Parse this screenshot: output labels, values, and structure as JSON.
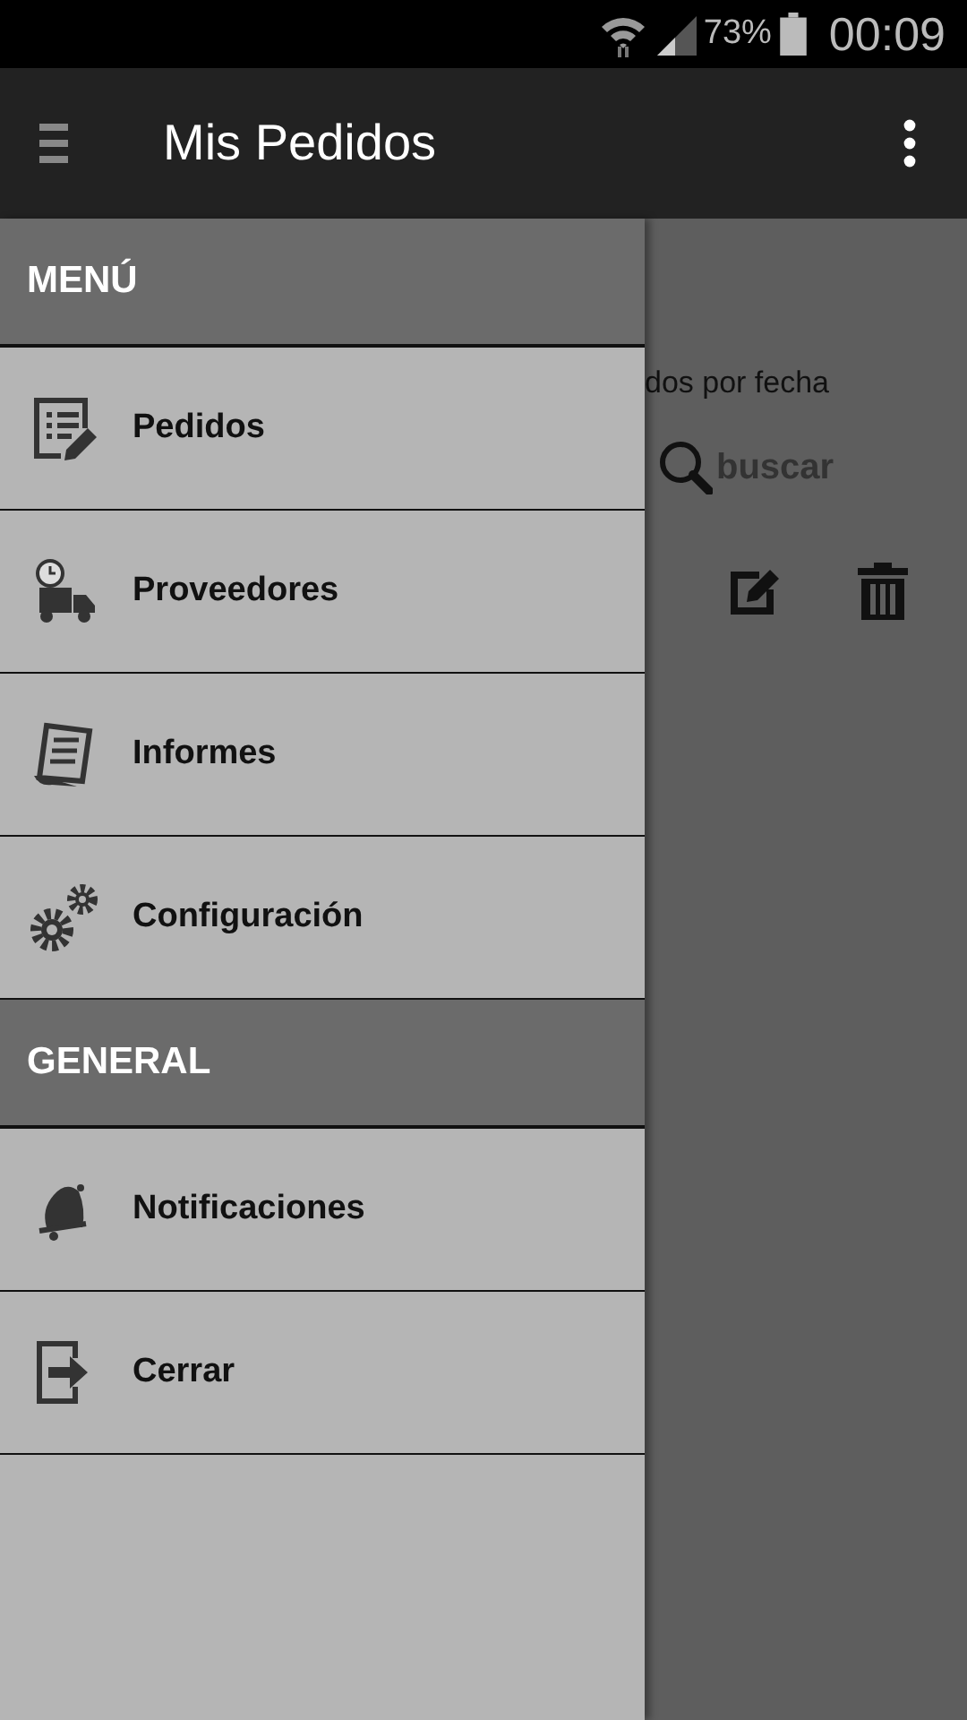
{
  "status_bar": {
    "battery": "73%",
    "time": "00:09"
  },
  "app_bar": {
    "title": "Mis Pedidos"
  },
  "content": {
    "filter_label": "dos por fecha",
    "search_button": "buscar"
  },
  "drawer": {
    "sections": [
      {
        "title": "MENÚ",
        "items": [
          {
            "label": "Pedidos",
            "kind": "orders"
          },
          {
            "label": "Proveedores",
            "kind": "suppliers"
          },
          {
            "label": "Informes",
            "kind": "reports"
          },
          {
            "label": "Configuración",
            "kind": "settings"
          }
        ]
      },
      {
        "title": "GENERAL",
        "items": [
          {
            "label": "Notificaciones",
            "kind": "notifications"
          },
          {
            "label": "Cerrar",
            "kind": "logout"
          }
        ]
      }
    ]
  }
}
